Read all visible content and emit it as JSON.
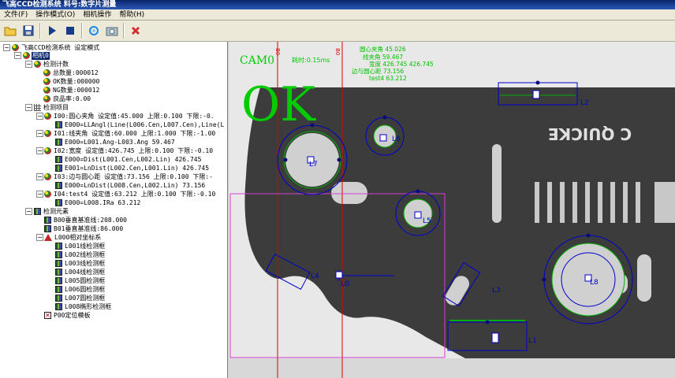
{
  "window": {
    "title": "飞高CCD检测系统 料号:数字片测量"
  },
  "menu": [
    "文件(F)",
    "操作模式(O)",
    "相机操作",
    "帮助(H)"
  ],
  "toolbar": [
    {
      "icon": "open-folder-icon"
    },
    {
      "icon": "save-icon"
    },
    {
      "icon": "run-icon"
    },
    {
      "icon": "stop-icon"
    },
    {
      "icon": "refresh-icon"
    },
    {
      "icon": "camera-icon"
    },
    {
      "icon": "delete-icon"
    }
  ],
  "tree": {
    "root": "飞高CCD检测系统 设定模式",
    "camera": "相机0",
    "count_group": "检测计数",
    "total": "总数量:000012",
    "ok": "OK数量:000000",
    "ng": "NG数量:000012",
    "yield": "良品率:0.00",
    "items_group": "检测项目",
    "i00": "I00:圆心夹角 设定值:45.000 上限:0.100 下限:-0.",
    "i00_e": "E000=LLAngl(Line(L006.Cen,L007.Cen),Line(L",
    "i01": "I01:线夹角 设定值:60.000 上限:1.000 下限:-1.00",
    "i01_e": "E000=L001.Ang-L003.Ang 59.467",
    "i02": "I02:宽度 设定值:426.745 上限:0.100 下限:-0.10",
    "i02_e0": "E000=Dist(L001.Cen,L002.Lin) 426.745",
    "i02_e1": "E001=LnDist(L002.Cen,L001.Lin) 426.745",
    "i03": "I03:边与圆心距 设定值:73.156 上限:0.100 下限:-",
    "i03_e": "E000=LnDist(L008.Cen,L002.Lin) 73.156",
    "i04": "I04:test4 设定值:63.212 上限:0.100 下限:-0.10",
    "i04_e": "E000=L008.IRa 63.212",
    "elements_group": "检测元素",
    "b00": "B00垂直基准线:208.000",
    "b01": "B01垂直基准线:86.000",
    "l000": "L000相对坐标系",
    "l001": "L001线检测框",
    "l002": "L002线检测框",
    "l003": "L003线检测框",
    "l004": "L004线检测框",
    "l005": "L005圆检测框",
    "l006": "L006圆检测框",
    "l007": "L007圆检测框",
    "l008": "L008椭形检测框",
    "p00": "P00定位模板"
  },
  "overlay": {
    "camera_label": "CAM0",
    "time_label": "耗时:0.15ms",
    "verdict": "OK",
    "measurements": [
      "圆心夹角 45.026",
      "线夹角 59.467",
      "宽度 426.745 426.745",
      "边与圆心距 73.156",
      "test4 63.212"
    ],
    "stamp_text": "C QUICKE",
    "ref_line_labels": [
      "B0",
      "B0"
    ],
    "roi_labels": [
      "L2",
      "L6",
      "L7",
      "L5",
      "L4",
      "L0",
      "L3",
      "L8",
      "L1"
    ]
  },
  "colors": {
    "ok_green": "#00cc00",
    "roi_blue": "#0000cc",
    "ref_red": "#e00000",
    "roi_magenta": "#d040d0",
    "measure_green": "#00c000"
  }
}
